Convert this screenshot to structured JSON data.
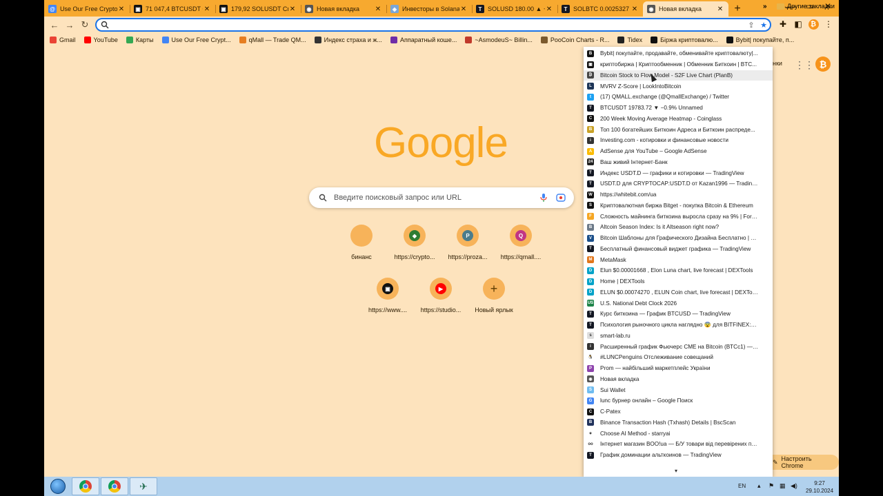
{
  "tabs": [
    {
      "title": "Use Our Free Crypto ",
      "icon": "web-icon",
      "color": "#4285f4",
      "glyph": "@"
    },
    {
      "title": "71 047,4 BTCUSDT Cr",
      "icon": "okx-icon",
      "color": "#111111",
      "glyph": "▣"
    },
    {
      "title": "179,92 SOLUSDT Спо",
      "icon": "okx-icon",
      "color": "#111111",
      "glyph": "▣"
    },
    {
      "title": "Новая вкладка",
      "icon": "chrome-icon",
      "color": "#555555",
      "glyph": "◉"
    },
    {
      "title": "Инвесторы в Solana",
      "icon": "web-icon",
      "color": "#7aa6d6",
      "glyph": "◈"
    },
    {
      "title": "SOLUSD 180.00 ▲ +",
      "icon": "tradingview-icon",
      "color": "#131722",
      "glyph": "T"
    },
    {
      "title": "SOLBTC 0.0025327 ▼",
      "icon": "tradingview-icon",
      "color": "#131722",
      "glyph": "T"
    },
    {
      "title": "Новая вкладка",
      "icon": "chrome-icon",
      "color": "#555555",
      "glyph": "◉",
      "active": true
    }
  ],
  "toolbar": {
    "back": "←",
    "forward": "→",
    "reload": "↻",
    "omnibox_value": ""
  },
  "bookmarks": [
    {
      "label": "Gmail",
      "color": "#ea4335"
    },
    {
      "label": "YouTube",
      "color": "#ff0000"
    },
    {
      "label": "Карты",
      "color": "#34a853"
    },
    {
      "label": "Use Our Free Crypt...",
      "color": "#4285f4"
    },
    {
      "label": "qMall — Trade QM...",
      "color": "#e67e22"
    },
    {
      "label": "Индекс страха и ж...",
      "color": "#333333"
    },
    {
      "label": "Аппаратный коше...",
      "color": "#6f2da8"
    },
    {
      "label": "~AsmodeuS~ Billin...",
      "color": "#c0392b"
    },
    {
      "label": "PooCoin Charts - R...",
      "color": "#7b5a2e"
    },
    {
      "label": "Tidex",
      "color": "#222222"
    },
    {
      "label": "Біржа криптовалю...",
      "color": "#111111"
    },
    {
      "label": "Bybit| покупайте, п...",
      "color": "#111111"
    }
  ],
  "bookmarks_more": "»",
  "other_bookmarks": "Другие закладки",
  "ntp": {
    "logo": "Google",
    "search_placeholder": "Введите поисковый запрос или URL",
    "customize_label": "Настроить Chrome",
    "partial_link": "нки",
    "shortcuts": [
      {
        "label": "бинанс",
        "color": "#f7b35a",
        "glyph": ""
      },
      {
        "label": "https://crypto...",
        "color": "#2e7d32",
        "glyph": "◆"
      },
      {
        "label": "https://proza...",
        "color": "#4a7c8c",
        "glyph": "P"
      },
      {
        "label": "https://qmall....",
        "color": "#c13584",
        "glyph": "Q"
      },
      {
        "label": "https://www....",
        "color": "#111111",
        "glyph": "▣"
      },
      {
        "label": "https://studio...",
        "color": "#ff0000",
        "glyph": "▶"
      },
      {
        "label": "Новый ярлык",
        "color": "none",
        "glyph": "+"
      }
    ]
  },
  "menu_items": [
    {
      "label": "Bybit| покупайте, продавайте, обменивайте криптовалюту|...",
      "color": "#111111",
      "glyph": "B"
    },
    {
      "label": "криптобиржа | Криптообменник | Обменник Биткоин | BTC...",
      "color": "#111111",
      "glyph": "▣"
    },
    {
      "label": "Bitcoin Stock to Flow Model - S2F Live Chart (PlanB)",
      "color": "#444444",
      "glyph": "₿",
      "hover": true
    },
    {
      "label": "MVRV Z-Score | LookIntoBitcoin",
      "color": "#1d3557",
      "glyph": "L"
    },
    {
      "label": "(17) QMALL.exchange (@QmallExchange) / Twitter",
      "color": "#1da1f2",
      "glyph": "t"
    },
    {
      "label": "BTCUSDT 19783.72 ▼ −0.9% Unnamed",
      "color": "#131722",
      "glyph": "T"
    },
    {
      "label": "200 Week Moving Average Heatmap - Coinglass",
      "color": "#111111",
      "glyph": "C"
    },
    {
      "label": "Топ 100 богатейших Биткоин Адреса и Биткоин распреде...",
      "color": "#c9a227",
      "glyph": "B"
    },
    {
      "label": "Investing.com - котировки и финансовые новости",
      "color": "#333333",
      "glyph": "i"
    },
    {
      "label": "AdSense для YouTube – Google AdSense",
      "color": "#fbbc05",
      "glyph": "A"
    },
    {
      "label": "Ваш живий Інтернет-Банк",
      "color": "#222222",
      "glyph": "24"
    },
    {
      "label": "Индекс USDT.D — графики и котировки — TradingView",
      "color": "#131722",
      "glyph": "T"
    },
    {
      "label": "USDT.D для CRYPTOCAP:USDT.D от Kazan1996 — TradingView",
      "color": "#131722",
      "glyph": "T"
    },
    {
      "label": "https://whitebit.com/ua",
      "color": "#111111",
      "glyph": "W"
    },
    {
      "label": "Криптовалютная биржа Bitget - покупка Bitcoin & Ethereum",
      "color": "#111111",
      "glyph": "S"
    },
    {
      "label": "Сложность майнинга биткоина выросла сразу на 9% | ForkL...",
      "color": "#f5a623",
      "glyph": "F"
    },
    {
      "label": "Altcoin Season Index: Is it Altseason right now?",
      "color": "#6c7a89",
      "glyph": "B"
    },
    {
      "label": "Bitcoin Шаблоны для Графического Дизайна Бесплатно | Vis...",
      "color": "#1b4f8a",
      "glyph": "V"
    },
    {
      "label": "Бесплатный финансовый виджет графика — TradingView",
      "color": "#131722",
      "glyph": "T"
    },
    {
      "label": "MetaMask",
      "color": "#e2761b",
      "glyph": "M"
    },
    {
      "label": "Elun $0.00001668 , Elon Luna chart, live forecast | DEXTools",
      "color": "#05a3c9",
      "glyph": "D"
    },
    {
      "label": "Home | DEXTools",
      "color": "#05a3c9",
      "glyph": "D"
    },
    {
      "label": "ELUN $0.00074270 , ELUN Coin chart, live forecast | DEXTools",
      "color": "#05a3c9",
      "glyph": "D"
    },
    {
      "label": "U.S. National Debt Clock 2026",
      "color": "#1e8449",
      "glyph": "US"
    },
    {
      "label": "Курс биткоина — График BTCUSD — TradingView",
      "color": "#131722",
      "glyph": "T"
    },
    {
      "label": "Психология рыночного цикла наглядно 😨 для BITFINEX:BTC...",
      "color": "#131722",
      "glyph": "T"
    },
    {
      "label": "smart-lab.ru",
      "color": "#dddddd",
      "glyph": "s"
    },
    {
      "label": "Расширенный график Фьючерс CME на Bitcoin (BTCc1) — In...",
      "color": "#333333",
      "glyph": "i"
    },
    {
      "label": "#LUNCPenguins Отслеживание совещаний",
      "color": "#ffffff",
      "glyph": "🐧"
    },
    {
      "label": "Prom — найбільший маркетплейс України",
      "color": "#8e44ad",
      "glyph": "P"
    },
    {
      "label": "Новая вкладка",
      "color": "#555555",
      "glyph": "◉"
    },
    {
      "label": "Sui Wallet",
      "color": "#6fbcf0",
      "glyph": "S"
    },
    {
      "label": "lunc бурнер онлайн – Google Поиск",
      "color": "#4285f4",
      "glyph": "G"
    },
    {
      "label": "C-Patex",
      "color": "#111111",
      "glyph": "C"
    },
    {
      "label": "Binance Transaction Hash (Txhash) Details | BscScan",
      "color": "#21325b",
      "glyph": "B"
    },
    {
      "label": "Choose AI Method - starryai",
      "color": "#ffffff",
      "glyph": "✦"
    },
    {
      "label": "Інтернет магазин BOO!ua — Б/У товари від перевірених пос...",
      "color": "#ffffff",
      "glyph": "oo"
    },
    {
      "label": "График доминации альткоинов — TradingView",
      "color": "#131722",
      "glyph": "T"
    }
  ],
  "menu_scroll_arrow": "▾",
  "taskbar": {
    "lang": "EN",
    "time": "9:27",
    "date": "29.10.2024"
  }
}
